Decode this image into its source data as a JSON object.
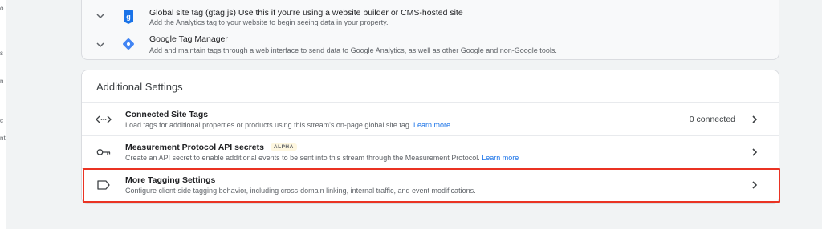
{
  "left_strip": {
    "fragments": [
      "o",
      "s",
      "n",
      "c",
      "nt"
    ]
  },
  "tags": [
    {
      "title_bold": "Global site tag (gtag.js)",
      "title_rest": " Use this if you're using a website builder or CMS-hosted site",
      "description": "Add the Analytics tag to your website to begin seeing data in your property."
    },
    {
      "title_bold": "Google Tag Manager",
      "title_rest": "",
      "description": "Add and maintain tags through a web interface to send data to Google Analytics, as well as other Google and non-Google tools."
    }
  ],
  "additional_settings": {
    "header": "Additional Settings",
    "rows": [
      {
        "title": "Connected Site Tags",
        "badge": "",
        "description": "Load tags for additional properties or products using this stream's on-page global site tag.",
        "link": "Learn more",
        "status": "0 connected",
        "icon": "code-brackets-icon"
      },
      {
        "title": "Measurement Protocol API secrets",
        "badge": "ALPHA",
        "description": "Create an API secret to enable additional events to be sent into this stream through the Measurement Protocol.",
        "link": "Learn more",
        "status": "",
        "icon": "key-icon"
      },
      {
        "title": "More Tagging Settings",
        "badge": "",
        "description": "Configure client-side tagging behavior, including cross-domain linking, internal traffic, and event modifications.",
        "link": "",
        "status": "",
        "icon": "label-icon"
      }
    ]
  },
  "colors": {
    "highlight": "#ea3323",
    "link": "#1a73e8",
    "gtm_blue": "#4285f4",
    "gtag_blue": "#1a73e8"
  }
}
